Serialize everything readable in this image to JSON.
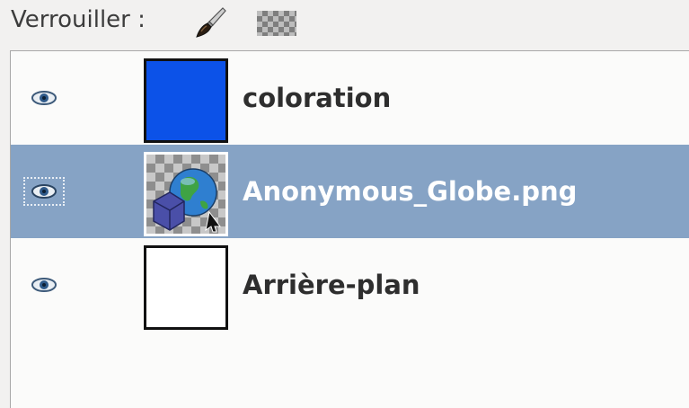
{
  "lock": {
    "label": "Verrouiller :",
    "icons": [
      "brush-lock-icon",
      "alpha-lock-icon"
    ]
  },
  "layers": [
    {
      "name": "coloration",
      "visible": true,
      "selected": false,
      "thumbnail": "solid-blue",
      "thumb_color": "#0c52e8"
    },
    {
      "name": "Anonymous_Globe.png",
      "visible": true,
      "selected": true,
      "thumbnail": "globe-image"
    },
    {
      "name": "Arrière-plan",
      "visible": true,
      "selected": false,
      "thumbnail": "solid-white",
      "thumb_color": "#ffffff"
    }
  ],
  "colors": {
    "selection": "#86a3c5",
    "panel_bg": "#fbfbfa",
    "toolbar_bg": "#f2f1f0"
  }
}
